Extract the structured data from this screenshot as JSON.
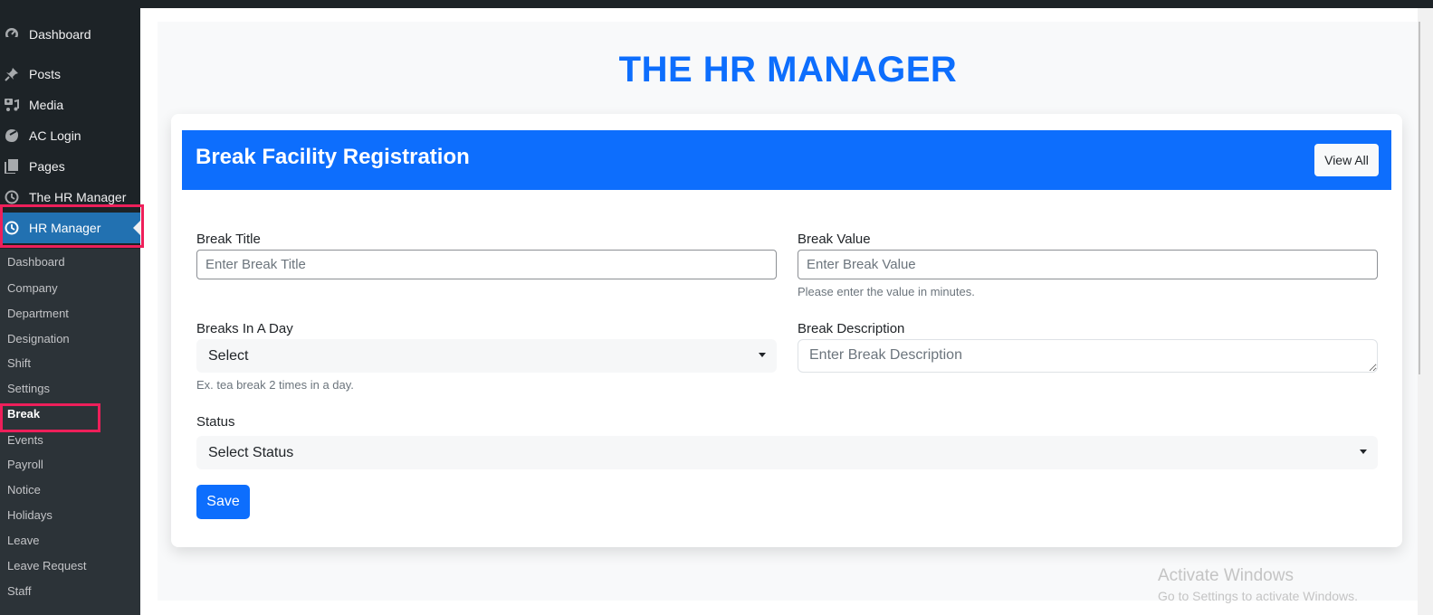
{
  "sidebar": {
    "menu": [
      {
        "label": "Dashboard",
        "icon": "dashboard-icon"
      },
      {
        "label": "Posts",
        "icon": "pin-icon"
      },
      {
        "label": "Media",
        "icon": "media-icon"
      },
      {
        "label": "AC Login",
        "icon": "palette-icon"
      },
      {
        "label": "Pages",
        "icon": "pages-icon"
      },
      {
        "label": "The HR Manager",
        "icon": "clock-icon"
      },
      {
        "label": "HR Manager",
        "icon": "clock-icon",
        "active": true
      }
    ],
    "submenu": [
      "Dashboard",
      "Company",
      "Department",
      "Designation",
      "Shift",
      "Settings",
      "Break",
      "Events",
      "Payroll",
      "Notice",
      "Holidays",
      "Leave",
      "Leave Request",
      "Staff"
    ],
    "current_submenu": "Break"
  },
  "page": {
    "title": "THE HR MANAGER"
  },
  "card": {
    "title": "Break Facility Registration",
    "view_all_label": "View All"
  },
  "form": {
    "break_title": {
      "label": "Break Title",
      "placeholder": "Enter Break Title",
      "value": ""
    },
    "break_value": {
      "label": "Break Value",
      "placeholder": "Enter Break Value",
      "value": "",
      "help": "Please enter the value in minutes."
    },
    "breaks_in_a_day": {
      "label": "Breaks In A Day",
      "selected": "Select",
      "help": "Ex. tea break 2 times in a day."
    },
    "break_description": {
      "label": "Break Description",
      "placeholder": "Enter Break Description",
      "value": ""
    },
    "status": {
      "label": "Status",
      "selected": "Select Status"
    },
    "save_label": "Save"
  },
  "watermark": {
    "line1": "Activate Windows",
    "line2": "Go to Settings to activate Windows."
  },
  "colors": {
    "primary": "#0d6efd",
    "sidebar_bg": "#1d2327",
    "active_menu": "#2271b1",
    "highlight": "#ee1f5a"
  }
}
